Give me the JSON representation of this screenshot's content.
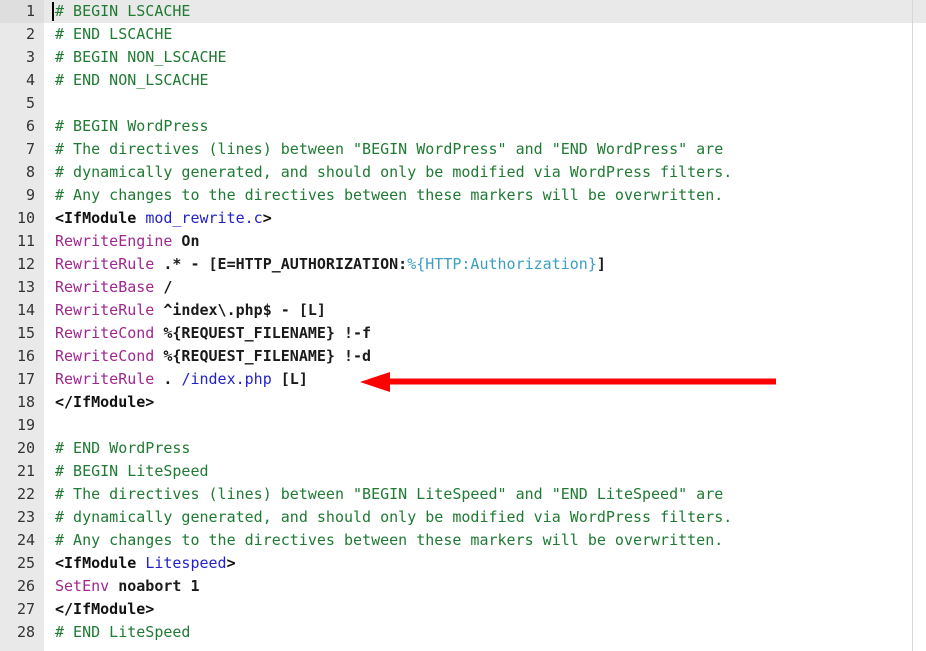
{
  "editor": {
    "name": "htaccess-code-editor",
    "active_line": 1,
    "caret_line": 1,
    "caret_column": 1,
    "total_lines": 28,
    "colors": {
      "background": "#ffffff",
      "gutter_background": "#e9e9e9",
      "active_line_background": "#e9e9e9",
      "line_number": "#333333",
      "comment": "#1f7a33",
      "directive_keyword": "#a0278f",
      "tag": "#111111",
      "value": "#2222cc",
      "plain": "#1a1a1a",
      "server_variable": "#3d9ec4",
      "annotation_arrow": "#ff0000",
      "right_edge_rule": "#d6d6d6"
    },
    "lines": [
      {
        "n": "1",
        "tokens": [
          {
            "c": "comment",
            "t": "# BEGIN LSCACHE"
          }
        ]
      },
      {
        "n": "2",
        "tokens": [
          {
            "c": "comment",
            "t": "# END LSCACHE"
          }
        ]
      },
      {
        "n": "3",
        "tokens": [
          {
            "c": "comment",
            "t": "# BEGIN NON_LSCACHE"
          }
        ]
      },
      {
        "n": "4",
        "tokens": [
          {
            "c": "comment",
            "t": "# END NON_LSCACHE"
          }
        ]
      },
      {
        "n": "5",
        "tokens": []
      },
      {
        "n": "6",
        "tokens": [
          {
            "c": "comment",
            "t": "# BEGIN WordPress"
          }
        ]
      },
      {
        "n": "7",
        "tokens": [
          {
            "c": "comment",
            "t": "# The directives (lines) between \"BEGIN WordPress\" and \"END WordPress\" are"
          }
        ]
      },
      {
        "n": "8",
        "tokens": [
          {
            "c": "comment",
            "t": "# dynamically generated, and should only be modified via WordPress filters."
          }
        ]
      },
      {
        "n": "9",
        "tokens": [
          {
            "c": "comment",
            "t": "# Any changes to the directives between these markers will be overwritten."
          }
        ]
      },
      {
        "n": "10",
        "tokens": [
          {
            "c": "tag",
            "t": "<IfModule "
          },
          {
            "c": "value",
            "t": "mod_rewrite.c"
          },
          {
            "c": "tag",
            "t": ">"
          }
        ]
      },
      {
        "n": "11",
        "tokens": [
          {
            "c": "keyword",
            "t": "RewriteEngine"
          },
          {
            "c": "plain",
            "t": " On"
          }
        ]
      },
      {
        "n": "12",
        "tokens": [
          {
            "c": "keyword",
            "t": "RewriteRule"
          },
          {
            "c": "plain",
            "t": " .* - [E=HTTP_AUTHORIZATION:"
          },
          {
            "c": "var",
            "t": "%{HTTP:Authorization}"
          },
          {
            "c": "plain",
            "t": "]"
          }
        ]
      },
      {
        "n": "13",
        "tokens": [
          {
            "c": "keyword",
            "t": "RewriteBase"
          },
          {
            "c": "plain",
            "t": " /"
          }
        ]
      },
      {
        "n": "14",
        "tokens": [
          {
            "c": "keyword",
            "t": "RewriteRule"
          },
          {
            "c": "plain",
            "t": " ^index\\.php$ - [L]"
          }
        ]
      },
      {
        "n": "15",
        "tokens": [
          {
            "c": "keyword",
            "t": "RewriteCond"
          },
          {
            "c": "plain",
            "t": " %{REQUEST_FILENAME} !-f"
          }
        ]
      },
      {
        "n": "16",
        "tokens": [
          {
            "c": "keyword",
            "t": "RewriteCond"
          },
          {
            "c": "plain",
            "t": " %{REQUEST_FILENAME} !-d"
          }
        ]
      },
      {
        "n": "17",
        "tokens": [
          {
            "c": "keyword",
            "t": "RewriteRule"
          },
          {
            "c": "plain",
            "t": " . "
          },
          {
            "c": "value",
            "t": "/index.php"
          },
          {
            "c": "plain",
            "t": " [L]"
          }
        ]
      },
      {
        "n": "18",
        "tokens": [
          {
            "c": "tag",
            "t": "</IfModule>"
          }
        ]
      },
      {
        "n": "19",
        "tokens": []
      },
      {
        "n": "20",
        "tokens": [
          {
            "c": "comment",
            "t": "# END WordPress"
          }
        ]
      },
      {
        "n": "21",
        "tokens": [
          {
            "c": "comment",
            "t": "# BEGIN LiteSpeed"
          }
        ]
      },
      {
        "n": "22",
        "tokens": [
          {
            "c": "comment",
            "t": "# The directives (lines) between \"BEGIN LiteSpeed\" and \"END LiteSpeed\" are"
          }
        ]
      },
      {
        "n": "23",
        "tokens": [
          {
            "c": "comment",
            "t": "# dynamically generated, and should only be modified via WordPress filters."
          }
        ]
      },
      {
        "n": "24",
        "tokens": [
          {
            "c": "comment",
            "t": "# Any changes to the directives between these markers will be overwritten."
          }
        ]
      },
      {
        "n": "25",
        "tokens": [
          {
            "c": "tag",
            "t": "<IfModule "
          },
          {
            "c": "value",
            "t": "Litespeed"
          },
          {
            "c": "tag",
            "t": ">"
          }
        ]
      },
      {
        "n": "26",
        "tokens": [
          {
            "c": "keyword",
            "t": "SetEnv"
          },
          {
            "c": "plain",
            "t": " noabort 1"
          }
        ]
      },
      {
        "n": "27",
        "tokens": [
          {
            "c": "tag",
            "t": "</IfModule>"
          }
        ]
      },
      {
        "n": "28",
        "tokens": [
          {
            "c": "comment",
            "t": "# END LiteSpeed"
          }
        ]
      }
    ]
  },
  "annotation": {
    "type": "arrow",
    "direction": "left",
    "color": "#ff0000",
    "points_at_line": "17",
    "points_at_text": "RewriteRule . /index.php [L]"
  }
}
